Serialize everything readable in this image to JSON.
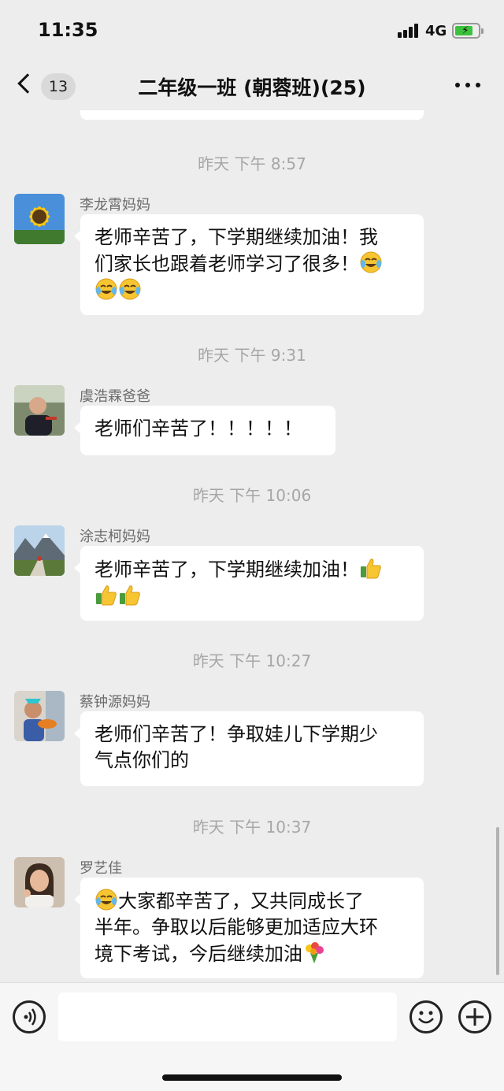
{
  "status_bar": {
    "time": "11:35",
    "network": "4G"
  },
  "nav": {
    "unread_count": "13",
    "title": "二年级一班 (朝蓉班)(25)"
  },
  "messages": [
    {
      "timestamp": "昨天 下午 8:57",
      "sender": "李龙霄妈妈",
      "lines": [
        "老师辛苦了，下学期继续加油！我",
        "们家长也跟着老师学习了很多！"
      ],
      "avatar_icon": "sunflower-avatar"
    },
    {
      "timestamp": "昨天 下午 9:31",
      "sender": "虞浩霖爸爸",
      "lines": [
        "老师们辛苦了！！！！！"
      ],
      "avatar_icon": "child-photo-avatar"
    },
    {
      "timestamp": "昨天 下午 10:06",
      "sender": "涂志柯妈妈",
      "lines": [
        "老师辛苦了，下学期继续加油！"
      ],
      "avatar_icon": "mountain-photo-avatar"
    },
    {
      "timestamp": "昨天 下午 10:27",
      "sender": "蔡钟源妈妈",
      "lines": [
        "老师们辛苦了！争取娃儿下学期少",
        "气点你们的"
      ],
      "avatar_icon": "child-with-bowl-avatar"
    },
    {
      "timestamp": "昨天 下午 10:37",
      "sender": "罗艺佳",
      "lines": [
        "大家都辛苦了，又共同成长了",
        "半年。争取以后能够更加适应大环",
        "境下考试，今后继续加油"
      ],
      "avatar_icon": "girl-photo-avatar"
    }
  ],
  "emoji": {
    "laugh": "laugh-cry-emoji",
    "thumb": "thumbs-up-emoji",
    "flower": "bouquet-emoji"
  },
  "input": {
    "placeholder": ""
  },
  "colors": {
    "background": "#ededed",
    "bubble": "#ffffff",
    "timestamp": "#a6a6a6",
    "sender": "#6b6b6b"
  }
}
